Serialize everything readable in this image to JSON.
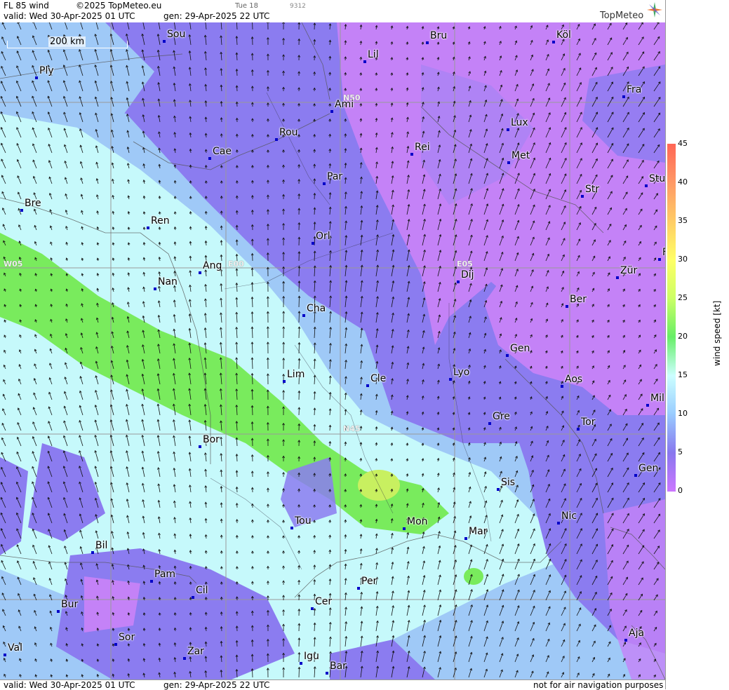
{
  "header": {
    "product": "FL 85 wind",
    "copyright": "©2025 TopMeteo.eu",
    "tue_label": "Tue 18",
    "code": "9312",
    "valid_line": "valid:  Wed  30-Apr-2025  01 UTC",
    "gen_line": "gen: 29-Apr-2025 22 UTC",
    "logo_text": "TopMeteo"
  },
  "footer": {
    "valid_line": "valid:  Wed  30-Apr-2025  01 UTC",
    "gen_line": "gen: 29-Apr-2025 22 UTC",
    "disclaimer": "not for air navigation purposes"
  },
  "scale_label": "200 km",
  "grid_labels": [
    "N50",
    "W05",
    "E00",
    "E05",
    "N45"
  ],
  "cities": [
    "Sou",
    "Bru",
    "Köl",
    "Lil",
    "Ply",
    "Fra",
    "Ami",
    "Lux",
    "Rou",
    "Cae",
    "Rei",
    "Met",
    "Par",
    "Stu",
    "Str",
    "Bre",
    "Ren",
    "Orl",
    "Ang",
    "Nan",
    "Dij",
    "Zür",
    "Ber",
    "Cha",
    "Gen",
    "Lim",
    "Cle",
    "Lyo",
    "Aos",
    "Mil",
    "Gre",
    "Tor",
    "Bor",
    "Gen",
    "Sis",
    "Tou",
    "Mon",
    "Nic",
    "Mar",
    "Bil",
    "Pam",
    "Cil",
    "Per",
    "Bur",
    "Cer",
    "Sor",
    "Aja",
    "Val",
    "Zar",
    "Igu",
    "Bar",
    "F"
  ],
  "legend": {
    "title": "wind speed [kt]",
    "ticks": [
      "45",
      "40",
      "35",
      "30",
      "25",
      "20",
      "15",
      "10",
      "5",
      "0"
    ],
    "colors": [
      "#ff6655",
      "#ff9966",
      "#ffcc66",
      "#ffff66",
      "#ccff66",
      "#66ee66",
      "#ccffff",
      "#99ccff",
      "#8877ee",
      "#cc77ff"
    ]
  },
  "colors": {
    "violet": "#c482f7",
    "purple_blue": "#8b7cf0",
    "light_blue": "#9fc9f7",
    "cyan": "#c6f9fb",
    "green": "#79eb5d",
    "yellow_green": "#c8f060"
  }
}
